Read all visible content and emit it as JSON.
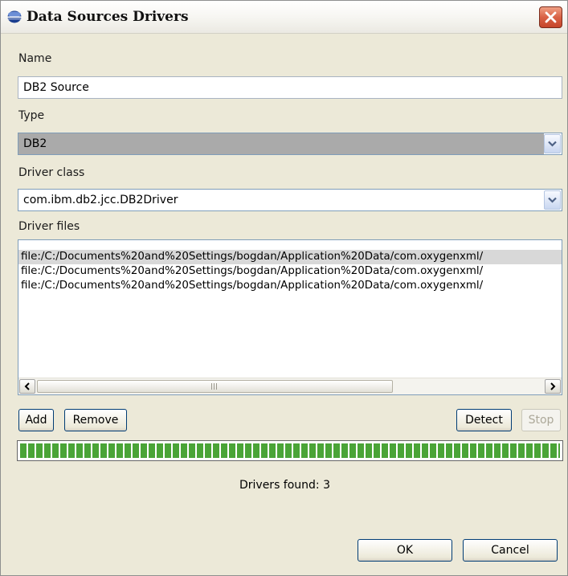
{
  "window": {
    "title": "Data Sources Drivers"
  },
  "name_section": {
    "label": "Name",
    "value": "DB2 Source"
  },
  "type_section": {
    "label": "Type",
    "value": "DB2"
  },
  "driver_class_section": {
    "label": "Driver class",
    "value": "com.ibm.db2.jcc.DB2Driver"
  },
  "driver_files_section": {
    "label": "Driver files",
    "files": [
      "file:/C:/Documents%20and%20Settings/bogdan/Application%20Data/com.oxygenxml/",
      "file:/C:/Documents%20and%20Settings/bogdan/Application%20Data/com.oxygenxml/",
      "file:/C:/Documents%20and%20Settings/bogdan/Application%20Data/com.oxygenxml/"
    ],
    "selected_index": 0
  },
  "buttons": {
    "add": "Add",
    "remove": "Remove",
    "detect": "Detect",
    "stop": "Stop",
    "ok": "OK",
    "cancel": "Cancel"
  },
  "progress": {
    "value_percent": 100,
    "color": "#4aa437"
  },
  "status": {
    "text": "Drivers found: 3"
  },
  "icons": {
    "app": "database-icon",
    "close": "close-icon",
    "dropdown": "chevron-down-icon",
    "scroll_left": "scroll-left-icon",
    "scroll_right": "scroll-right-icon"
  },
  "colors": {
    "close_button": "#d96246",
    "selected_combo": "#aaaaaa",
    "dialog_bg": "#ece9d8"
  }
}
